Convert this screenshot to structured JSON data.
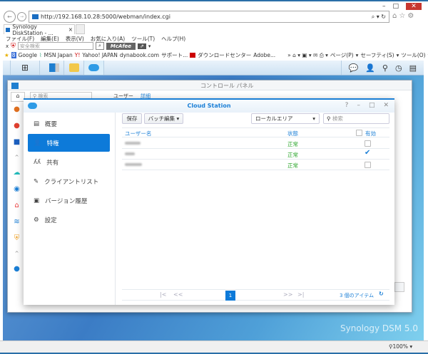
{
  "browser": {
    "url": "http://192.168.10.28:5000/webman/index.cgi",
    "tab_title": "Synology DiskStation - ...",
    "menu": [
      "ファイル(F)",
      "編集(E)",
      "表示(V)",
      "お気に入り(A)",
      "ツール(T)",
      "ヘルプ(H)"
    ],
    "safety_search_placeholder": "安全検索",
    "mcafee": "McAfee",
    "favorites": [
      "Google",
      "MSN Japan",
      "Yahoo! JAPAN",
      "dynabook.com",
      "サポート...",
      "ダウンロードセンター",
      "Adobe..."
    ],
    "cmd": [
      "ページ(P)",
      "セーフティ(S)",
      "ツール(O)"
    ],
    "zoom": "100%"
  },
  "control_panel": {
    "title": "コントロール パネル",
    "search_placeholder": "検索",
    "tabs": [
      "ユーザー",
      "詳細"
    ]
  },
  "cloud_station": {
    "title": "Cloud Station",
    "nav": [
      {
        "label": "概要",
        "icon": "overview-icon"
      },
      {
        "label": "特権",
        "icon": "privilege-icon",
        "active": true
      },
      {
        "label": "共有",
        "icon": "share-icon"
      },
      {
        "label": "クライアントリスト",
        "icon": "client-list-icon"
      },
      {
        "label": "バージョン履歴",
        "icon": "version-history-icon"
      },
      {
        "label": "設定",
        "icon": "settings-icon"
      }
    ],
    "toolbar": {
      "save": "保存",
      "batch_edit": "バッチ編集",
      "filter": "ローカルエリア",
      "search_placeholder": "検索"
    },
    "columns": [
      "ユーザー名",
      "状態",
      "有効"
    ],
    "rows": [
      {
        "status": "正常",
        "enabled": false
      },
      {
        "status": "正常",
        "enabled": true
      },
      {
        "status": "正常",
        "enabled": false
      }
    ],
    "pager": {
      "page": "1",
      "count": "3 個のアイテム"
    }
  },
  "branding": "Synology DSM 5.0",
  "colors": {
    "accent": "#0d7ad9",
    "ok": "#2aa52a"
  }
}
